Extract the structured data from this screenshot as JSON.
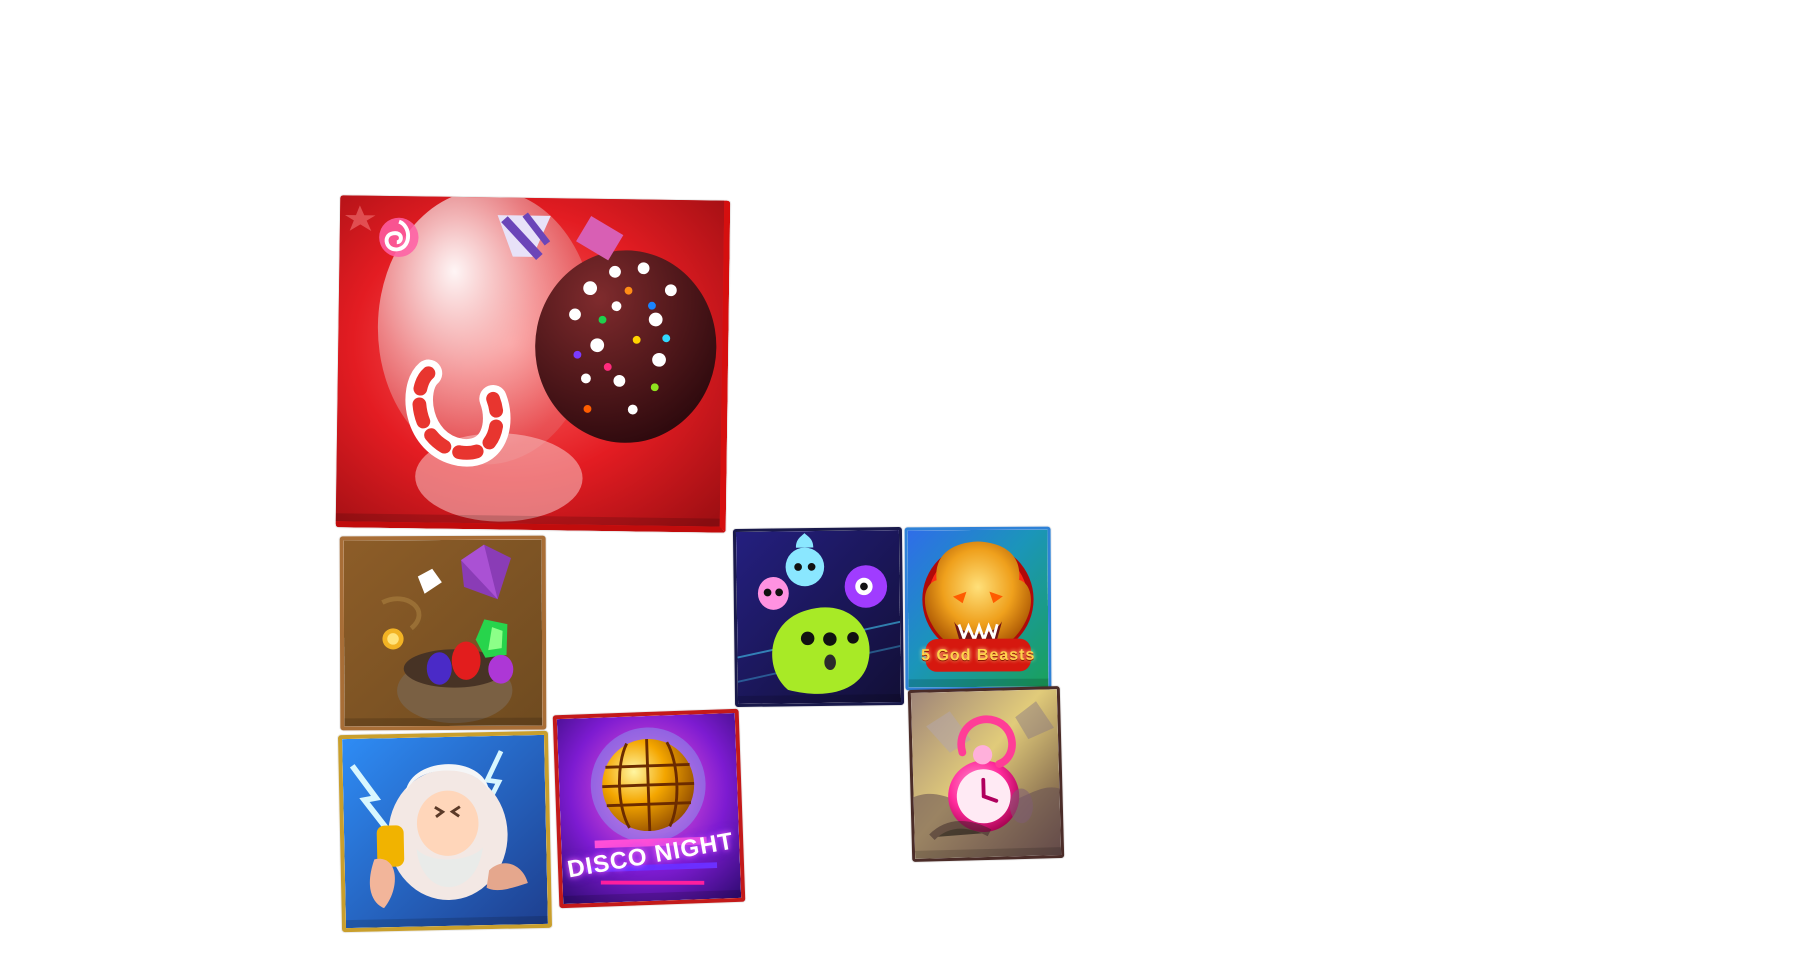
{
  "screen": {
    "background_color": "#ffffff"
  },
  "game_tiles": [
    {
      "id": "candy-game",
      "icon_name": "candy-icon",
      "primary_color": "#d7161b"
    },
    {
      "id": "gems-game",
      "icon_name": "gems-icon",
      "primary_color": "#8a5a2c"
    },
    {
      "id": "zeus-game",
      "icon_name": "zeus-icon",
      "primary_color": "#2b67c5"
    },
    {
      "id": "disco-game",
      "label": "DISCO NIGHT",
      "icon_name": "disco-ball-icon",
      "primary_color": "#8f1ec6"
    },
    {
      "id": "aliens-game",
      "icon_name": "alien-icon",
      "primary_color": "#1d1f7f"
    },
    {
      "id": "beasts-game",
      "label": "5 God Beasts",
      "icon_name": "dragon-icon",
      "primary_color": "#1b8e63"
    },
    {
      "id": "time-game",
      "icon_name": "clock-icon",
      "primary_color": "#9c6b78"
    }
  ]
}
